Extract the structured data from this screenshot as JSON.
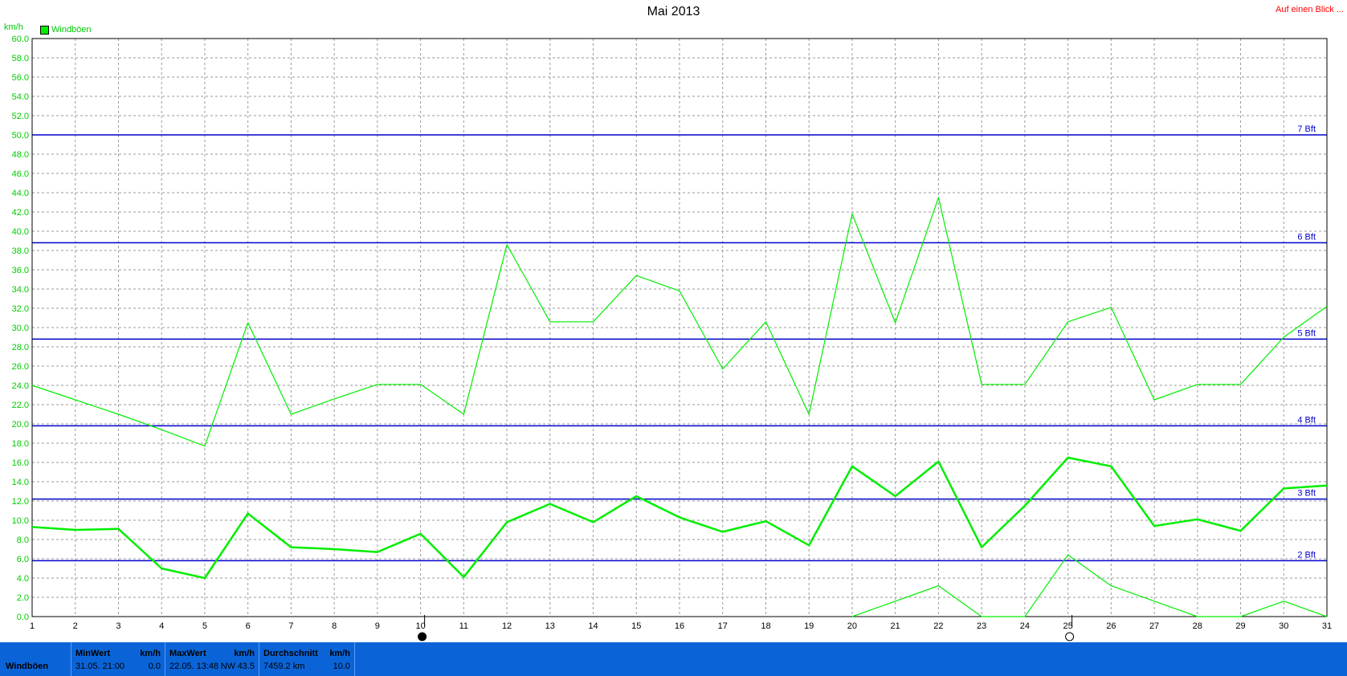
{
  "header": {
    "title": "Mai 2013",
    "link": "Auf einen Blick ...",
    "unit": "km/h",
    "legend": "Windböen"
  },
  "colors": {
    "line": "#00ee00",
    "axis_text": "#00cc00",
    "beaufort": "#0000cc",
    "grid": "#9a9a9a",
    "statbar": "#0a64d8"
  },
  "chart_data": {
    "type": "line",
    "x": [
      1,
      2,
      3,
      4,
      5,
      6,
      7,
      8,
      9,
      10,
      11,
      12,
      13,
      14,
      15,
      16,
      17,
      18,
      19,
      20,
      21,
      22,
      23,
      24,
      25,
      26,
      27,
      28,
      29,
      30,
      31
    ],
    "xlim": [
      1,
      31
    ],
    "ylim": [
      0,
      60
    ],
    "ytick_step": 2,
    "grid": true,
    "ylabel": "km/h",
    "series": [
      {
        "name": "Windböen",
        "style": "thin",
        "values": [
          24.0,
          22.5,
          21.0,
          19.4,
          17.7,
          30.5,
          21.0,
          22.6,
          24.1,
          24.1,
          21.0,
          38.6,
          30.6,
          30.6,
          35.4,
          33.8,
          25.7,
          30.6,
          21.0,
          41.8,
          30.5,
          43.5,
          24.1,
          24.1,
          30.6,
          32.1,
          22.5,
          24.1,
          24.1,
          29.0,
          32.2
        ]
      },
      {
        "style": "thick",
        "values": [
          9.3,
          9.0,
          9.1,
          5.0,
          4.0,
          10.7,
          7.2,
          7.0,
          6.7,
          8.6,
          4.1,
          9.8,
          11.7,
          9.8,
          12.5,
          10.3,
          8.8,
          9.9,
          7.4,
          15.6,
          12.5,
          16.1,
          7.2,
          11.5,
          16.5,
          15.6,
          9.4,
          10.1,
          8.9,
          13.3,
          13.6
        ]
      },
      {
        "style": "thin",
        "values": [
          null,
          null,
          null,
          null,
          null,
          null,
          null,
          null,
          null,
          null,
          null,
          null,
          null,
          null,
          null,
          null,
          null,
          null,
          null,
          0.0,
          1.6,
          3.2,
          0.0,
          0.0,
          6.4,
          3.2,
          1.6,
          0.0,
          0.0,
          1.6,
          0.0
        ]
      }
    ],
    "reference_lines": [
      {
        "label": "2 Bft",
        "value": 5.8
      },
      {
        "label": "3 Bft",
        "value": 12.2
      },
      {
        "label": "4 Bft",
        "value": 19.8
      },
      {
        "label": "5 Bft",
        "value": 28.8
      },
      {
        "label": "6 Bft",
        "value": 38.8
      },
      {
        "label": "7 Bft",
        "value": 50.0
      }
    ],
    "moon_phases": [
      {
        "day": 10,
        "phase": "new"
      },
      {
        "day": 25,
        "phase": "full"
      }
    ]
  },
  "stats": {
    "row_label": "Windböen",
    "min": {
      "header": "MinWert",
      "unit": "km/h",
      "time": "31.05. 21:00",
      "value": "0.0"
    },
    "max": {
      "header": "MaxWert",
      "unit": "km/h",
      "time": "22.05. 13:48",
      "dir": "NW",
      "value": "43.5"
    },
    "avg": {
      "header": "Durchschnitt",
      "unit": "km/h",
      "distance": "7459.2 km",
      "value": "10.0"
    }
  }
}
